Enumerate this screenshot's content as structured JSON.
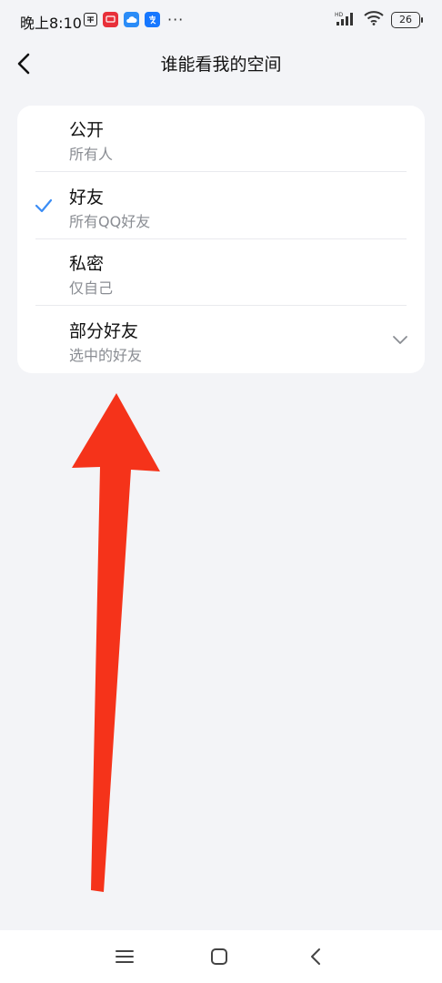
{
  "status_bar": {
    "time": "晚上8:10",
    "more": "···",
    "battery": "26",
    "signal_label": "HD",
    "app_icons": [
      "pinduoduo-icon",
      "message-icon",
      "cloud-icon",
      "alipay-icon"
    ]
  },
  "header": {
    "title": "谁能看我的空间"
  },
  "options": [
    {
      "title": "公开",
      "subtitle": "所有人",
      "selected": false
    },
    {
      "title": "好友",
      "subtitle": "所有QQ好友",
      "selected": true
    },
    {
      "title": "私密",
      "subtitle": "仅自己",
      "selected": false
    },
    {
      "title": "部分好友",
      "subtitle": "选中的好友",
      "selected": false,
      "expandable": true
    }
  ],
  "colors": {
    "accent": "#3b8df5",
    "annotation_arrow": "#f5331a",
    "background": "#f3f4f7"
  },
  "nav_bar": {
    "icons": [
      "menu-icon",
      "home-icon",
      "back-icon"
    ]
  }
}
